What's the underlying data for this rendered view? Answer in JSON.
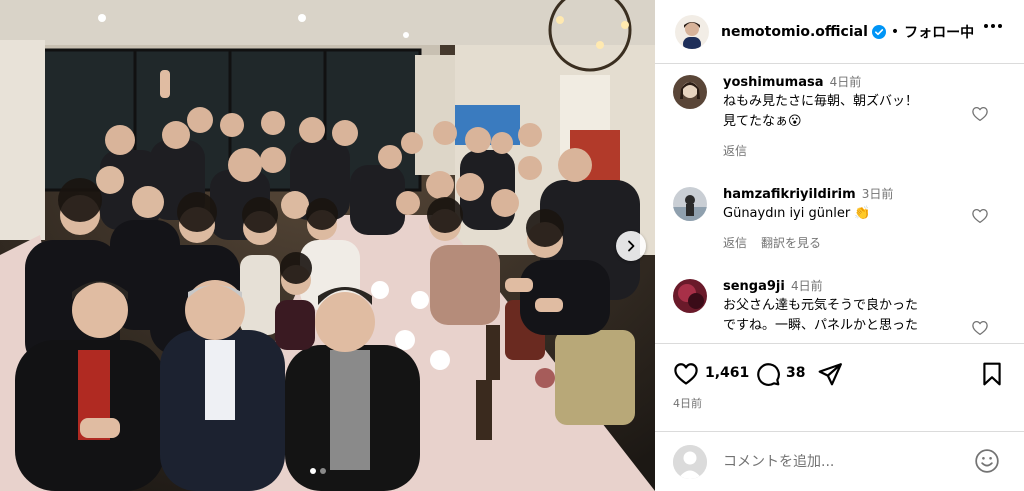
{
  "post": {
    "username": "nemotomio.official",
    "separator": "•",
    "follow_label": "フォロー中"
  },
  "comments": [
    {
      "username": "yoshimumasa",
      "time": "4日前",
      "text_lines": [
        "ねもみ見たさに毎朝、朝ズバッ！",
        "見てたなぁ😮"
      ],
      "reply_label": "返信"
    },
    {
      "username": "hamzafikriyildirim",
      "time": "3日前",
      "text_lines": [
        "Günaydın iyi günler 👏"
      ],
      "reply_label": "返信",
      "translate_label": "翻訳を見る"
    },
    {
      "username": "senga9ji",
      "time": "4日前",
      "text_lines": [
        "お父さん達も元気そうで良かった",
        "ですね。一瞬、パネルかと思った"
      ]
    }
  ],
  "actions": {
    "like_count": "1,461",
    "comment_count": "38",
    "posted_time": "4日前"
  },
  "comment_box": {
    "placeholder": "コメントを追加..."
  },
  "icons": {
    "header_more": "more-horizontal-icon",
    "verified": "verified-badge-icon",
    "like": "heart-icon",
    "comment": "comment-bubble-icon",
    "share": "paper-plane-icon",
    "save": "bookmark-icon",
    "emoji": "smiley-icon",
    "carousel": "chevron-right-icon"
  },
  "colors": {
    "verified_blue": "#0095f6",
    "border": "#dbdbdb",
    "secondary_text": "#737373"
  }
}
